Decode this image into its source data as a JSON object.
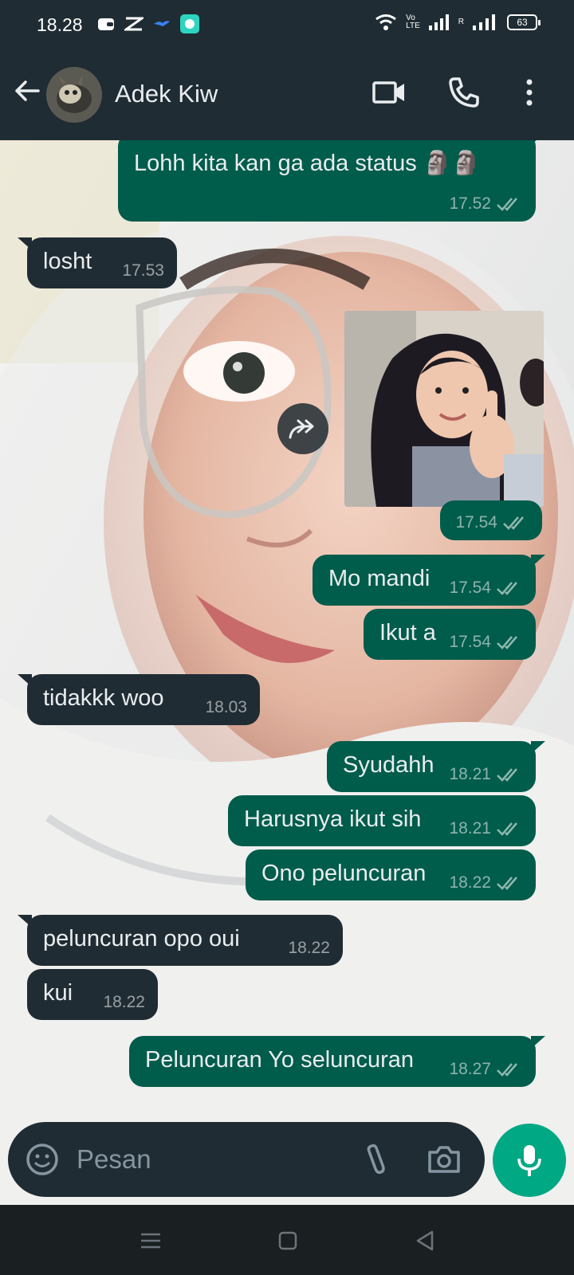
{
  "status_bar": {
    "time": "18.28",
    "battery": "63",
    "volte": "Vo\nLTE",
    "roaming": "R"
  },
  "header": {
    "contact_name": "Adek Kiw",
    "icons": [
      "back-arrow-icon",
      "avatar",
      "video-call-icon",
      "voice-call-icon",
      "more-vert-icon"
    ]
  },
  "messages": [
    {
      "dir": "out",
      "text": "Lohh kita kan ga ada status 🗿🗿",
      "time": "17.52"
    },
    {
      "dir": "in",
      "text": "losht",
      "time": "17.53"
    },
    {
      "dir": "out",
      "type": "image",
      "text": "",
      "time": "17.54"
    },
    {
      "dir": "out",
      "text": "Mo mandi",
      "time": "17.54"
    },
    {
      "dir": "out",
      "text": "Ikut a",
      "time": "17.54"
    },
    {
      "dir": "in",
      "text": "tidakkk woo",
      "time": "18.03"
    },
    {
      "dir": "out",
      "text": "Syudahh",
      "time": "18.21"
    },
    {
      "dir": "out",
      "text": "Harusnya ikut sih",
      "time": "18.21"
    },
    {
      "dir": "out",
      "text": "Ono peluncuran",
      "time": "18.22"
    },
    {
      "dir": "in",
      "text": "peluncuran opo oui",
      "time": "18.22"
    },
    {
      "dir": "in",
      "text": "kui",
      "time": "18.22"
    },
    {
      "dir": "out",
      "text": "Peluncuran Yo seluncuran",
      "time": "18.27"
    }
  ],
  "input": {
    "placeholder": "Pesan"
  },
  "colors": {
    "header_bg": "#1f2c34",
    "outgoing_bubble": "#005c4b",
    "incoming_bubble": "#202c33",
    "accent": "#00a884",
    "read_ticks": "#8fb8ad"
  }
}
